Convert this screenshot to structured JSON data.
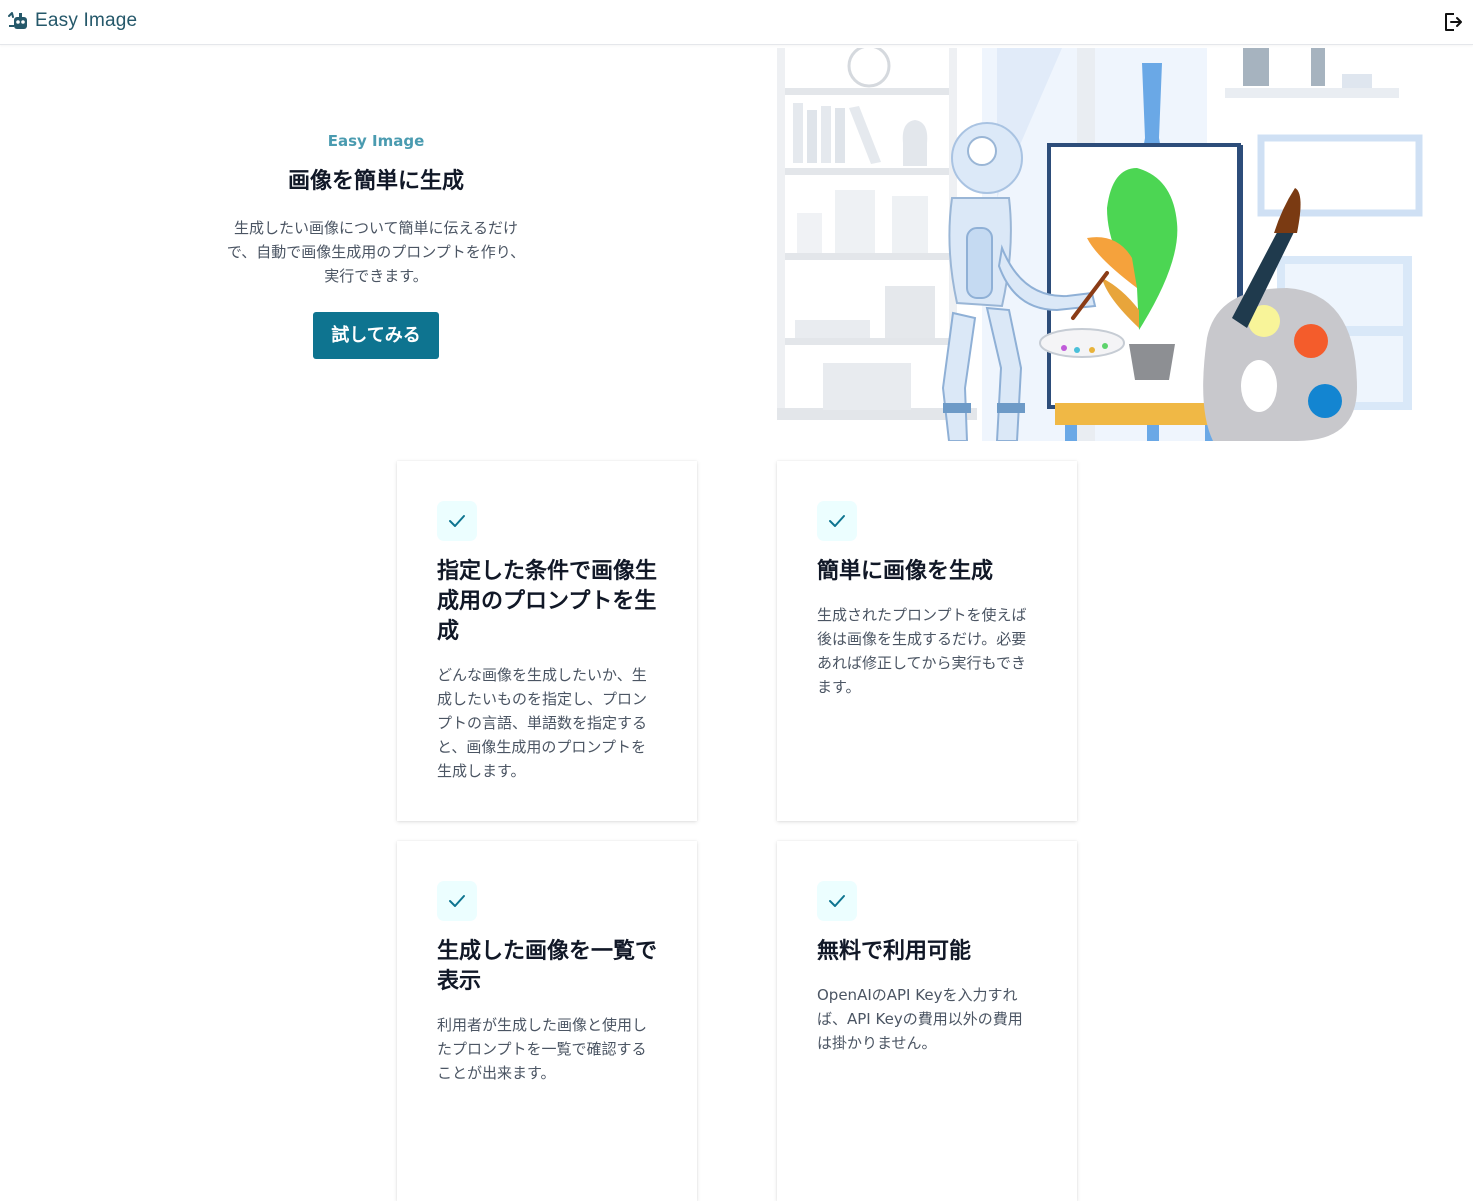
{
  "header": {
    "brand": "Easy Image",
    "logo_icon": "robot-icon",
    "logout_icon": "logout-icon"
  },
  "hero": {
    "eyebrow": "Easy Image",
    "title": "画像を簡単に生成",
    "description": "生成したい画像について簡単に伝えるだけで、自動で画像生成用のプロンプトを作り、実行できます。",
    "cta_label": "試してみる"
  },
  "features": [
    {
      "title": "指定した条件で画像生成用のプロンプトを生成",
      "text": "どんな画像を生成したいか、生成したいものを指定し、プロンプトの言語、単語数を指定すると、画像生成用のプロンプトを生成します。"
    },
    {
      "title": "簡単に画像を生成",
      "text": "生成されたプロンプトを使えば後は画像を生成するだけ。必要あれば修正してから実行もできます。"
    },
    {
      "title": "生成した画像を一覧で表示",
      "text": "利用者が生成した画像と使用したプロンプトを一覧で確認することが出来ます。"
    },
    {
      "title": "無料で利用可能",
      "text": "OpenAIのAPI Keyを入力すれば、API Keyの費用以外の費用は掛かりません。"
    }
  ],
  "colors": {
    "brand": "#25586a",
    "accent": "#0e7490",
    "eyebrow": "#4a9bb0",
    "check_bg": "#ecfeff"
  }
}
